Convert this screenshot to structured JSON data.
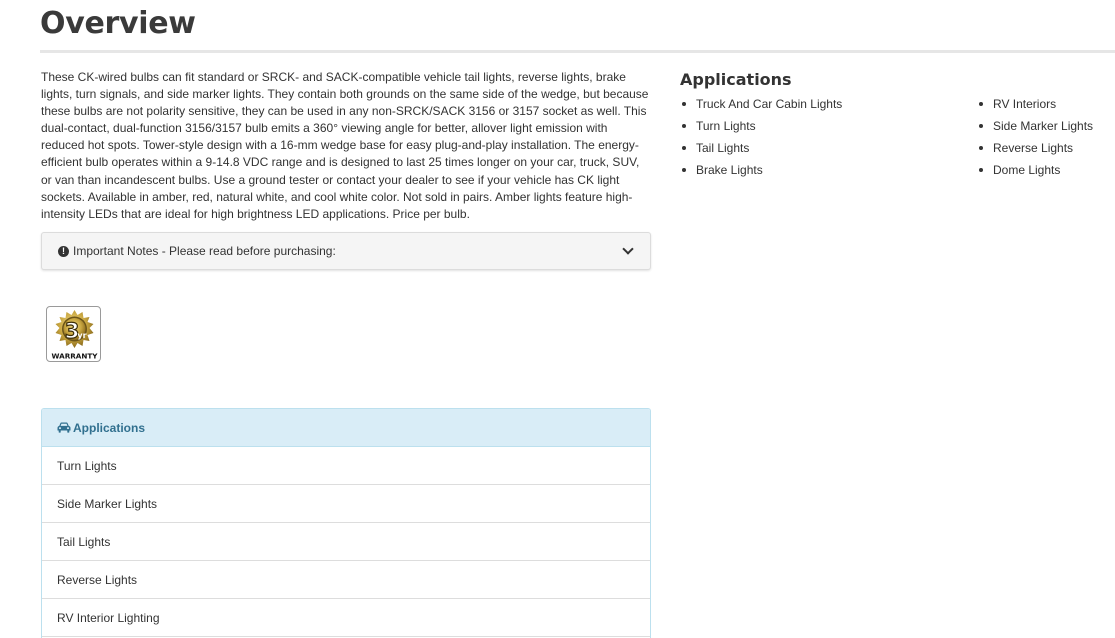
{
  "overview": {
    "title": "Overview",
    "description": "These CK-wired bulbs can fit standard or SRCK- and SACK-compatible vehicle tail lights, reverse lights, brake lights, turn signals, and side marker lights. They contain both grounds on the same side of the wedge, but because these bulbs are not polarity sensitive, they can be used in any non-SRCK/SACK 3156 or 3157 socket as well. This dual-contact, dual-function 3156/3157 bulb emits a 360° viewing angle for better, allover light emission with reduced hot spots. Tower-style design with a 16-mm wedge base for easy plug-and-play installation. The energy-efficient bulb operates within a 9-14.8 VDC range and is designed to last 25 times longer on your car, truck, SUV, or van than incandescent bulbs. Use a ground tester or contact your dealer to see if your vehicle has CK light sockets. Available in amber, red, natural white, and cool white color. Not sold in pairs. Amber lights feature high-intensity LEDs that are ideal for high brightness LED applications. Price per bulb."
  },
  "notes": {
    "icon": "exclamation-circle-icon",
    "label": "Important Notes - Please read before purchasing:",
    "expand_icon": "chevron-down-icon"
  },
  "warranty": {
    "number": "3",
    "unit": "yr",
    "label": "WARRANTY"
  },
  "applications_panel": {
    "icon": "car-icon",
    "heading": "Applications",
    "items": [
      "Turn Lights",
      "Side Marker Lights",
      "Tail Lights",
      "Reverse Lights",
      "RV Interior Lighting"
    ]
  },
  "applications_list": {
    "title": "Applications",
    "col1": [
      "Truck And Car Cabin Lights",
      "Turn Lights",
      "Tail Lights",
      "Brake Lights"
    ],
    "col2": [
      "RV Interiors",
      "Side Marker Lights",
      "Reverse Lights",
      "Dome Lights"
    ]
  },
  "colors": {
    "panel_heading_bg": "#d9edf7",
    "panel_heading_text": "#31708f",
    "notes_bg": "#f5f5f5",
    "badge_gold": "#c8a640"
  }
}
